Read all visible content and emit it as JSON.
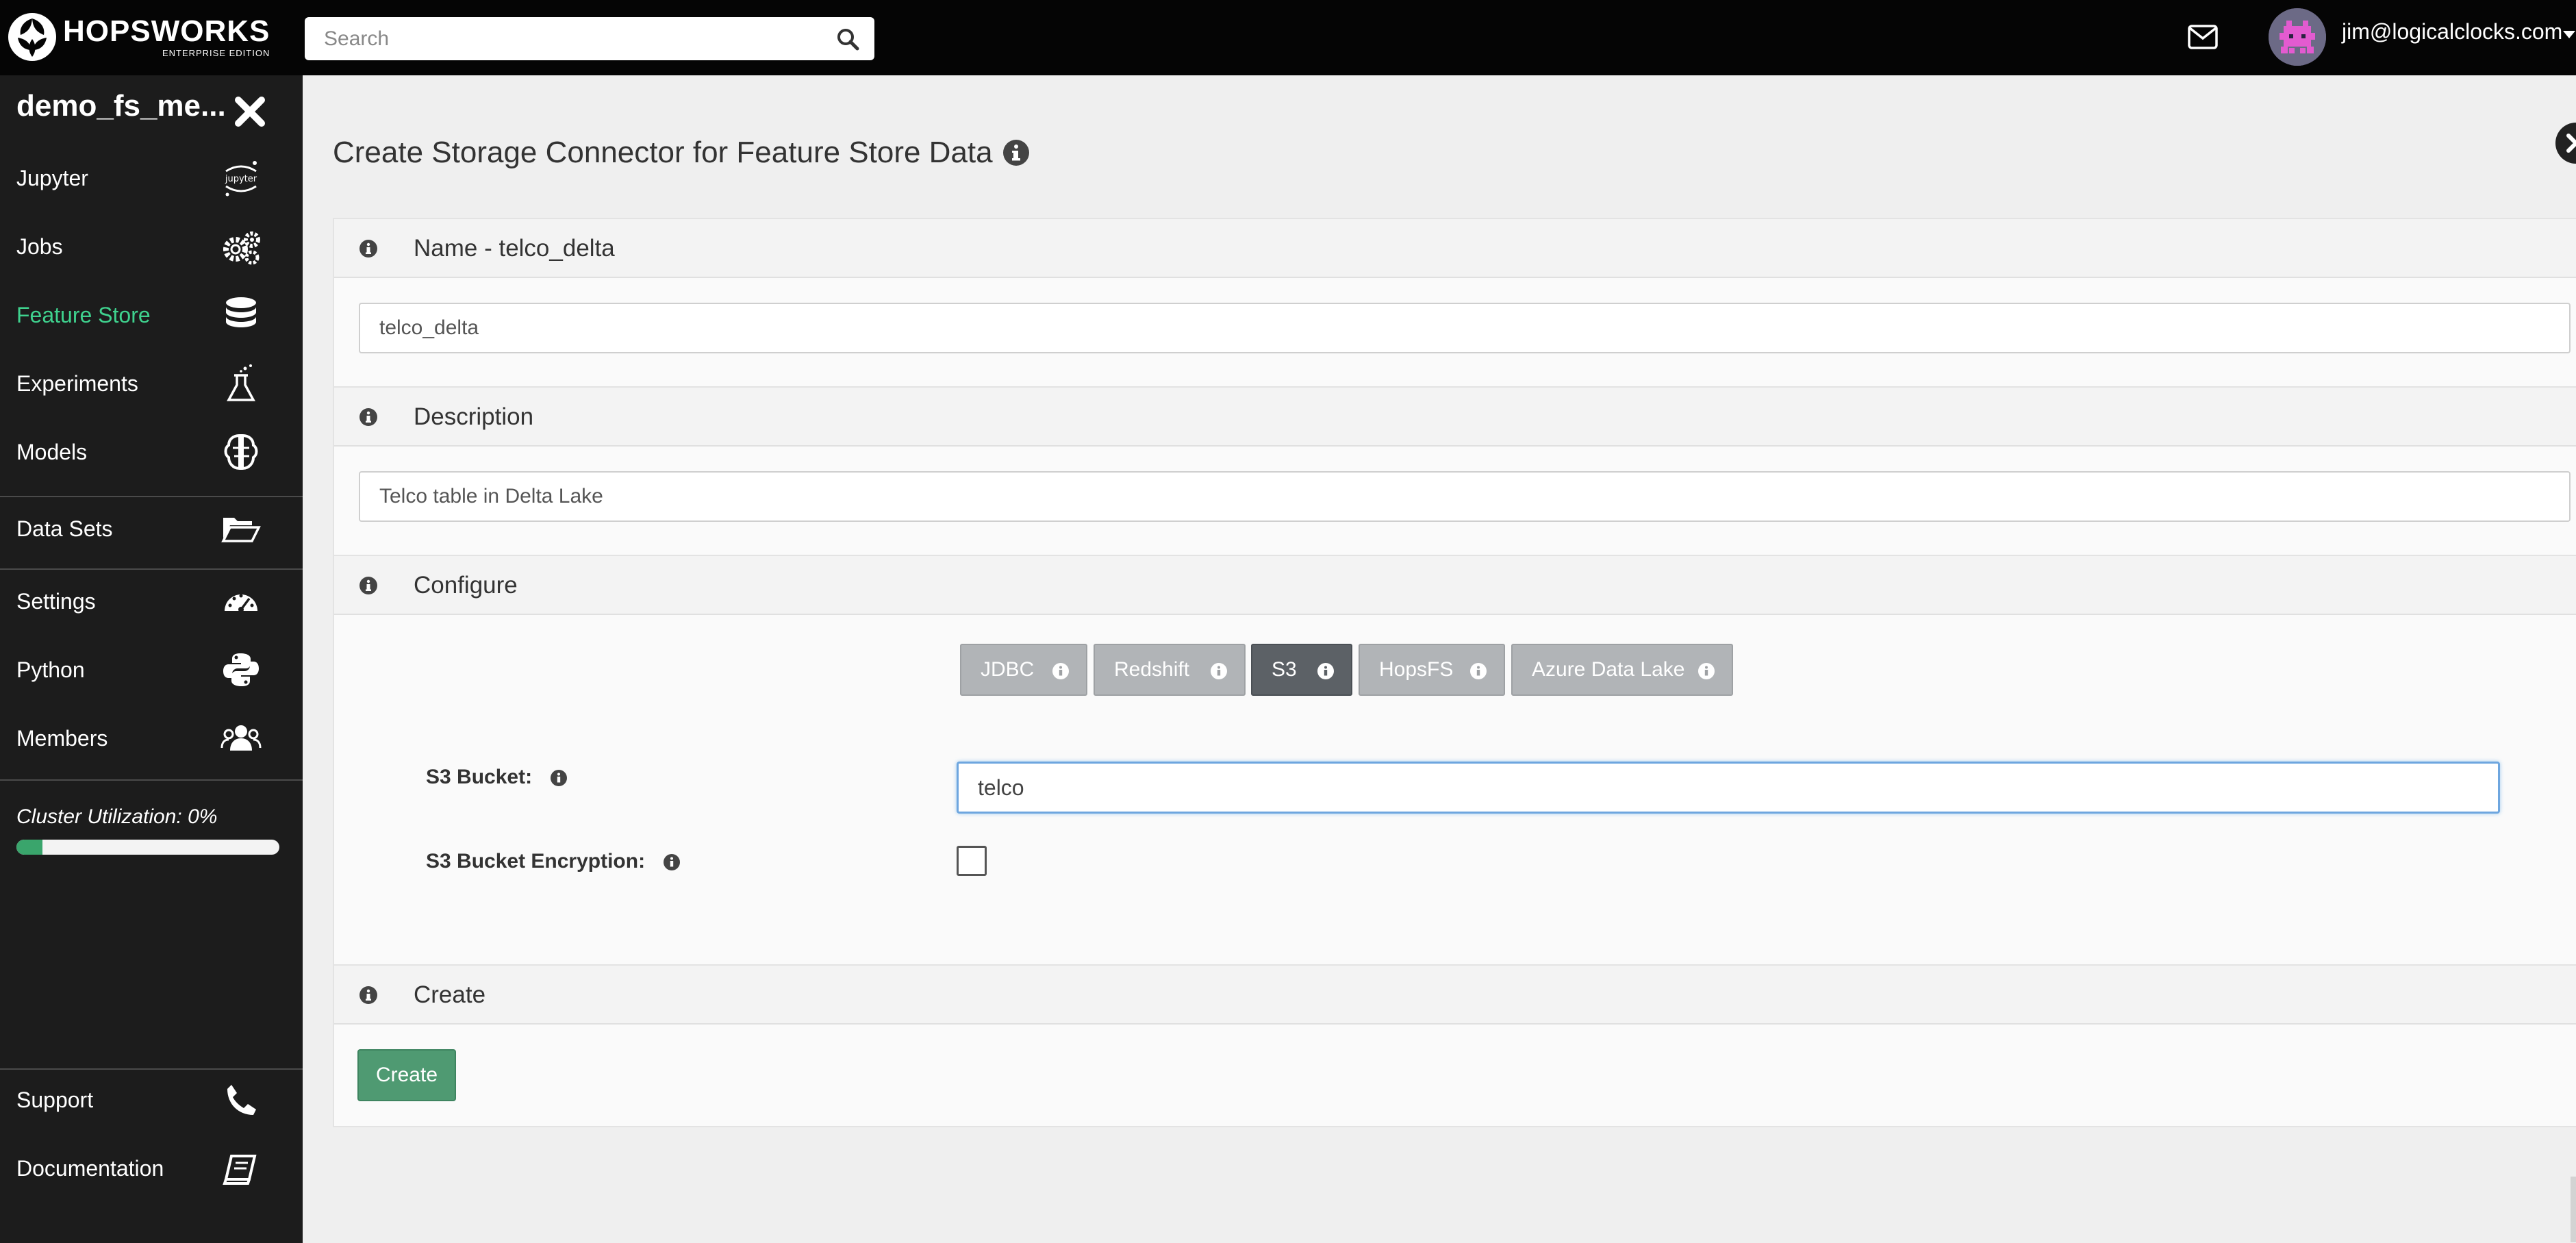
{
  "app": {
    "brand": "HOPSWORKS",
    "edition": "ENTERPRISE EDITION",
    "search_placeholder": "Search",
    "user_email": "jim@logicalclocks.com"
  },
  "sidebar": {
    "project_name": "demo_fs_me...",
    "items": [
      {
        "label": "Jupyter",
        "icon": "jupyter-icon",
        "active": false
      },
      {
        "label": "Jobs",
        "icon": "gears-icon",
        "active": false
      },
      {
        "label": "Feature Store",
        "icon": "database-icon",
        "active": true
      },
      {
        "label": "Experiments",
        "icon": "flask-icon",
        "active": false
      },
      {
        "label": "Models",
        "icon": "brain-icon",
        "active": false
      },
      {
        "label": "Data Sets",
        "icon": "folder-open-icon",
        "active": false
      },
      {
        "label": "Settings",
        "icon": "dashboard-icon",
        "active": false
      },
      {
        "label": "Python",
        "icon": "python-icon",
        "active": false
      },
      {
        "label": "Members",
        "icon": "users-icon",
        "active": false
      },
      {
        "label": "Support",
        "icon": "phone-icon",
        "active": false
      },
      {
        "label": "Documentation",
        "icon": "book-icon",
        "active": false
      }
    ],
    "cluster_label": "Cluster Utilization: 0%",
    "cluster_utilization_percent": 0
  },
  "main": {
    "title": "Create Storage Connector for Feature Store Data",
    "panels": {
      "name": {
        "title": "Name - telco_delta",
        "value": "telco_delta"
      },
      "description": {
        "title": "Description",
        "value": "Telco table in Delta Lake"
      },
      "configure": {
        "title": "Configure",
        "tabs": [
          {
            "label": "JDBC",
            "active": false
          },
          {
            "label": "Redshift",
            "active": false
          },
          {
            "label": "S3",
            "active": true
          },
          {
            "label": "HopsFS",
            "active": false
          },
          {
            "label": "Azure Data Lake",
            "active": false
          }
        ],
        "s3_bucket_label": "S3 Bucket:",
        "s3_bucket_value": "telco",
        "s3_encryption_label": "S3 Bucket Encryption:",
        "s3_encryption_checked": false
      },
      "create": {
        "title": "Create",
        "button_label": "Create"
      }
    }
  },
  "colors": {
    "active_nav": "#3fd28e",
    "create_button": "#4f9a72",
    "active_tab": "#5c6166",
    "inactive_tab": "#b1b4b7",
    "focus_border": "#6ea6df"
  }
}
